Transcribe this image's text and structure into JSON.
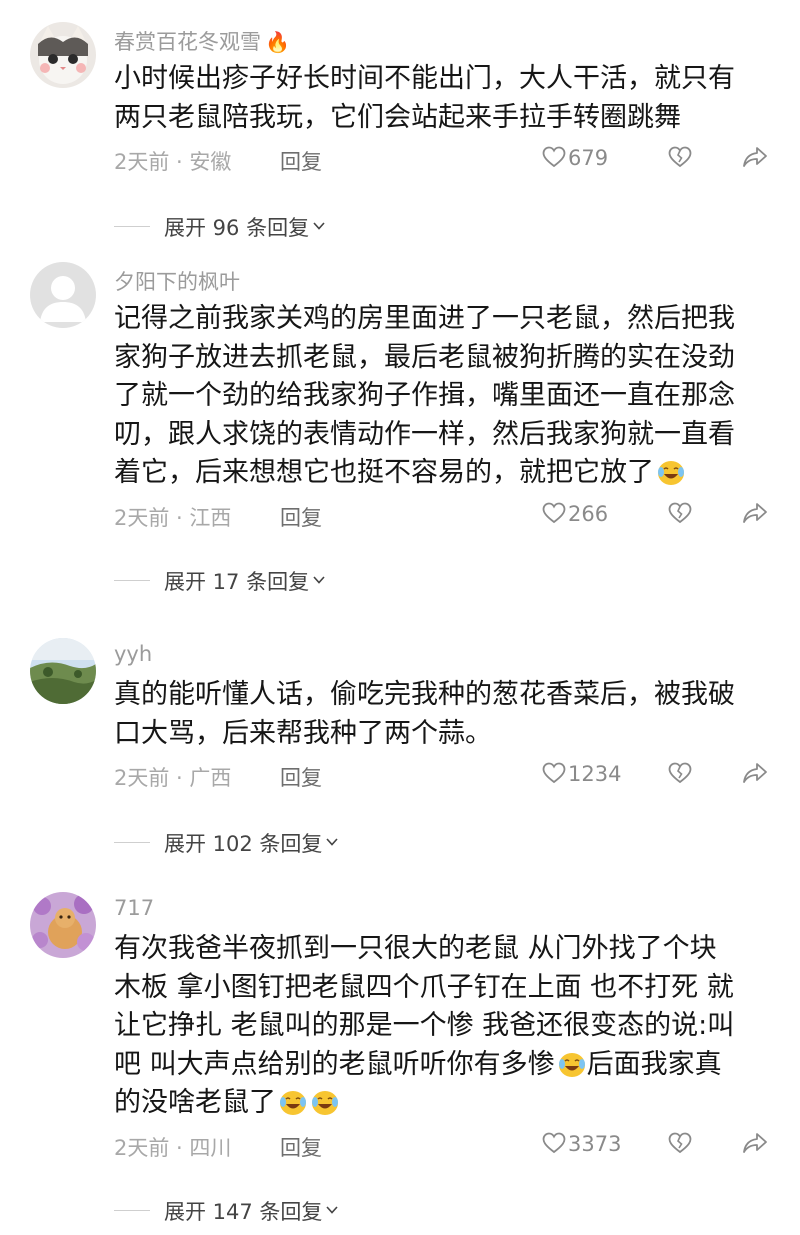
{
  "reply_label": "回复",
  "comments": [
    {
      "username": "春赏百花冬观雪",
      "has_fire_badge": true,
      "fire_glyph": "🔥",
      "lines": [
        "小时候出疹子好长时间不能出门，大人干活，就只有",
        "两只老鼠陪我玩，它们会站起来手拉手转圈跳舞"
      ],
      "time_loc": "2天前 · 安徽",
      "likes": "679",
      "expand_text": "展开 96 条回复"
    },
    {
      "username": "夕阳下的枫叶",
      "lines": [
        "记得之前我家关鸡的房里面进了一只老鼠，然后把我",
        "家狗子放进去抓老鼠，最后老鼠被狗折腾的实在没劲",
        "了就一个劲的给我家狗子作揖，嘴里面还一直在那念",
        "叨，跟人求饶的表情动作一样，然后我家狗就一直看",
        "着它，后来想想它也挺不容易的，就把它放了"
      ],
      "time_loc": "2天前 · 江西",
      "likes": "266",
      "expand_text": "展开 17 条回复"
    },
    {
      "username": "yyh",
      "lines": [
        "真的能听懂人话，偷吃完我种的葱花香菜后，被我破",
        "口大骂，后来帮我种了两个蒜。"
      ],
      "time_loc": "2天前 · 广西",
      "likes": "1234",
      "expand_text": "展开 102 条回复"
    },
    {
      "username": "717",
      "lines": [
        "有次我爸半夜抓到一只很大的老鼠 从门外找了个块",
        "木板 拿小图钉把老鼠四个爪子钉在上面 也不打死 就",
        "让它挣扎 老鼠叫的那是一个惨 我爸还很变态的说:叫",
        "吧 叫大声点给别的老鼠听听你有多惨",
        "的没啥老鼠了"
      ],
      "line4_tail": "后面我家真",
      "time_loc": "2天前 · 四川",
      "likes": "3373",
      "expand_text": "展开 147 条回复"
    }
  ],
  "icons": {
    "like": "heart-outline-icon",
    "dislike": "broken-heart-icon",
    "share": "share-arrow-icon",
    "emoji": "laugh-cry-emoji-icon",
    "expand": "chevron-down-icon"
  },
  "colors": {
    "username": "#9b9b9b",
    "content": "#161616",
    "meta": "#a8a8a8",
    "fire": "#f2622e",
    "emoji_face": "#f7c531"
  }
}
